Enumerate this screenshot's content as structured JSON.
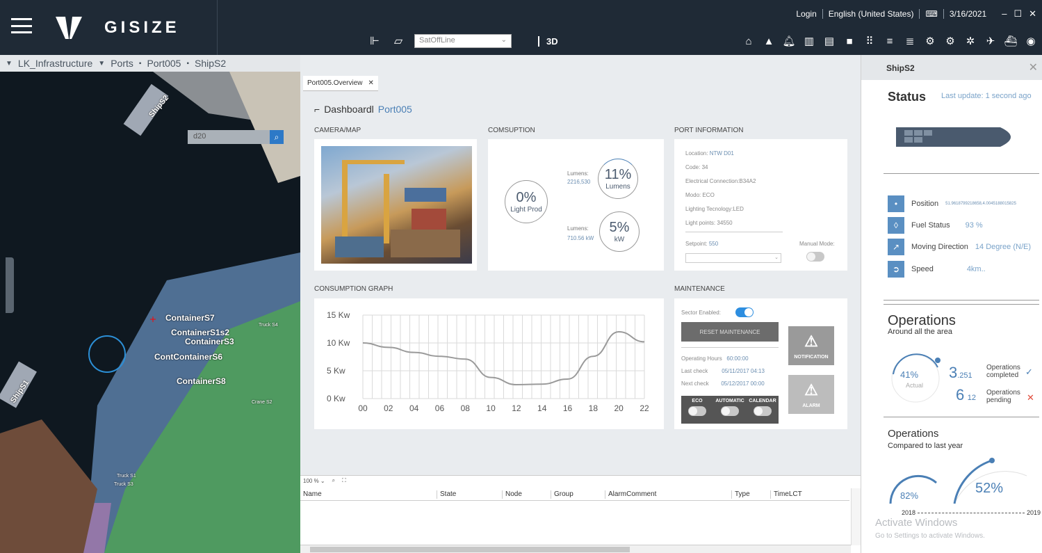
{
  "app": {
    "brand": "GISIZE"
  },
  "top": {
    "login": "Login",
    "language": "English (United States)",
    "date": "3/16/2021"
  },
  "toolbar": {
    "select_value": "SatOffLine",
    "btn_3d": "3D"
  },
  "breadcrumb": [
    "LK_Infrastructure",
    "Ports",
    "Port005",
    "ShipS2"
  ],
  "map": {
    "search_value": "d20",
    "labels": [
      "ShipS2",
      "ShipS1",
      "ContainerS7",
      "ContainerS1s2",
      "ContainerS3",
      "ContContainerS6",
      "ContainerS8",
      "Truck S4",
      "Crane S2",
      "Truck S1",
      "Truck S3"
    ]
  },
  "tab": {
    "label": "Port005.Overview"
  },
  "dashboard": {
    "title": "Dashboardl",
    "port": "Port005",
    "sections": {
      "camera": "CAMERA/MAP",
      "consumption": "COMSUPTION",
      "port_info": "PORT INFORMATION",
      "graph": "CONSUMPTION GRAPH",
      "maintenance": "MAINTENANCE"
    },
    "consumption": {
      "light_prod_value": "0%",
      "light_prod_label": "Light Prod",
      "lumens_pct": "11%",
      "lumens_pct_label": "Lumens",
      "lumens_label_1": "Lumens:",
      "lumens_value_1": "2216,530",
      "kw_pct": "5%",
      "kw_pct_label": "kW",
      "lumens_label_2": "Lumens:",
      "lumens_value_2": "710.56 kW"
    },
    "port_info": {
      "location_label": "Location:",
      "location": "NTW D01",
      "code_label": "Code:",
      "code": "34",
      "elec_label": "Electrical Connection:",
      "elec": "B34A2",
      "modo_label": "Modo:",
      "modo": "ECO",
      "tech_label": "Lighting Tecnology:",
      "tech": "LED",
      "points_label": "Light points:",
      "points": "34550",
      "setpoint_label": "Setpoint:",
      "setpoint": "550",
      "manual_label": "Manual Mode:"
    },
    "maintenance": {
      "sector_label": "Sector Enabled:",
      "reset_btn": "RESET MAINTENANCE",
      "op_hours_label": "Operating Hours",
      "op_hours": "60:00:00",
      "last_label": "Last check",
      "last": "05/11/2017 04:13",
      "next_label": "Next check",
      "next": "05/12/2017 00:00",
      "eco": "ECO",
      "automatic": "AUTOMATIC",
      "calendar": "CALENDAR",
      "notification": "NOTIFICATION",
      "alarm": "ALARM"
    }
  },
  "chart_data": {
    "type": "line",
    "x": [
      "00",
      "02",
      "04",
      "06",
      "08",
      "10",
      "12",
      "14",
      "16",
      "18",
      "20",
      "22"
    ],
    "yticks": [
      "15 Kw",
      "10 Kw",
      "5 Kw",
      "0 Kw"
    ],
    "ylim": [
      0,
      15
    ],
    "series": [
      {
        "values": [
          10.0,
          9.2,
          8.3,
          7.6,
          7.1,
          3.8,
          2.5,
          2.6,
          3.5,
          7.6,
          12.0,
          10.2
        ]
      }
    ],
    "grid": true
  },
  "grid": {
    "zoom": "100 %",
    "columns": [
      "Name",
      "State",
      "Node",
      "Group",
      "AlarmComment",
      "Type",
      "TimeLCT"
    ]
  },
  "rpanel": {
    "title": "ShipS2",
    "status": "Status",
    "last_update": "Last update: 1 second ago",
    "position_label": "Position",
    "position_value": "51.9618799218658,4.0045188015825",
    "fuel_label": "Fuel Status",
    "fuel_value": "93 %",
    "direction_label": "Moving Direction",
    "direction_value": "14 Degree (N/E)",
    "speed_label": "Speed",
    "speed_value": "4km..",
    "operations_title": "Operations",
    "operations_sub": "Around all the area",
    "ops_pct": "41%",
    "ops_pct_label": "Actual",
    "ops_completed_big": "3",
    "ops_completed_small": ".251",
    "ops_completed_label": "Operations completed",
    "ops_pending_big": "6",
    "ops_pending_small": "12",
    "ops_pending_label": "Operations pending",
    "compare_title": "Operations",
    "compare_sub": "Compared to last year",
    "pct_2018": "82%",
    "pct_2019": "52%",
    "year_2018": "2018",
    "year_2019": "2019",
    "watermark_1": "Activate Windows",
    "watermark_2": "Go to Settings to activate Windows."
  }
}
